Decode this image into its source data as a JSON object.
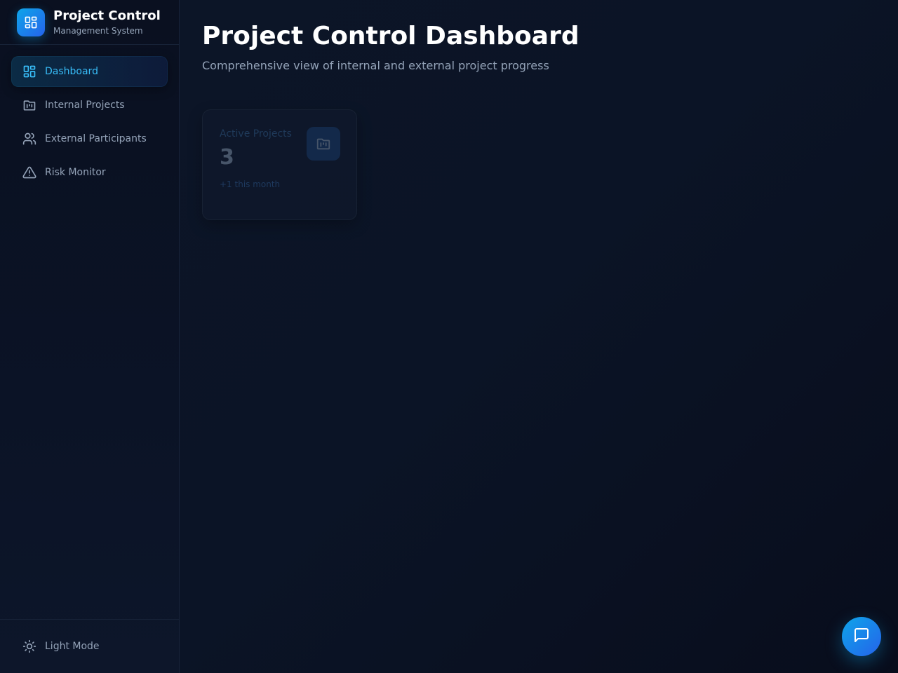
{
  "brand": {
    "title": "Project Control",
    "subtitle": "Management System",
    "logo_icon": "dashboard-grid-icon",
    "accent": "#0ea5e9"
  },
  "sidebar": {
    "items": [
      {
        "label": "Dashboard",
        "icon": "dashboard-grid-icon",
        "active": true
      },
      {
        "label": "Internal Projects",
        "icon": "folder-chart-icon",
        "active": false
      },
      {
        "label": "External Participants",
        "icon": "users-icon",
        "active": false
      },
      {
        "label": "Risk Monitor",
        "icon": "warning-triangle-icon",
        "active": false
      }
    ],
    "footer": {
      "label": "Light Mode",
      "icon": "sun-icon"
    }
  },
  "main": {
    "title": "Project Control Dashboard",
    "subtitle": "Comprehensive view of internal and external project progress",
    "cards": [
      {
        "label": "Active Projects",
        "value": "3",
        "delta": "+1 this month",
        "icon": "folder-chart-icon"
      }
    ]
  },
  "chat": {
    "icon": "chat-bubble-icon"
  },
  "colors": {
    "background": "#0b1120",
    "active_nav_text": "#38bdf8",
    "muted_text": "#94a3b8"
  }
}
